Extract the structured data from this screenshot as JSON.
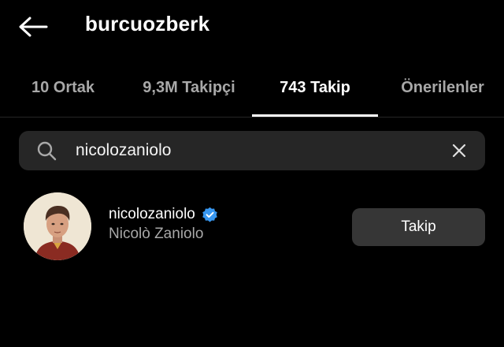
{
  "header": {
    "username": "burcuozberk",
    "back_icon": "back-arrow-icon"
  },
  "tabs": [
    {
      "label": "10 Ortak",
      "active": false
    },
    {
      "label": "9,3M Takipçi",
      "active": false
    },
    {
      "label": "743 Takip",
      "active": true
    },
    {
      "label": "Önerilenler",
      "active": false
    }
  ],
  "search": {
    "value": "nicolozaniolo",
    "search_icon": "search-icon",
    "clear_icon": "close-icon"
  },
  "result": {
    "username": "nicolozaniolo",
    "full_name": "Nicolò Zaniolo",
    "verified": true,
    "verified_color": "#3897f0",
    "button_label": "Takip"
  },
  "colors": {
    "background": "#000000",
    "primary_text": "#ffffff",
    "secondary_text": "#a8a8a8",
    "search_bg": "#262626",
    "button_bg": "#363636"
  }
}
